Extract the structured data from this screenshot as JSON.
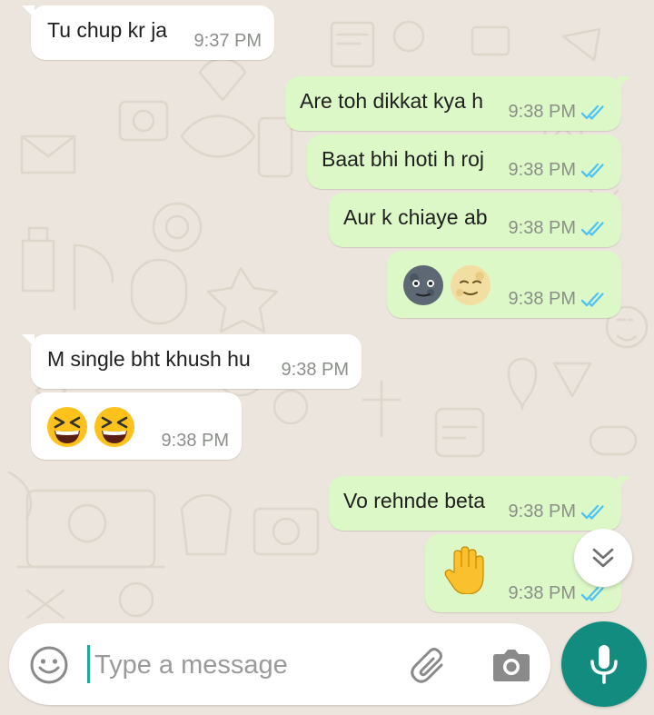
{
  "colors": {
    "incoming_bubble": "#ffffff",
    "outgoing_bubble": "#dcf8c6",
    "read_ticks": "#4fc3f7",
    "timestamp": "#8b8f8a",
    "accent": "#128c7e",
    "wallpaper": "#ece5dd"
  },
  "messages": [
    {
      "direction": "incoming",
      "text": "Tu chup kr ja",
      "time": "9:37 PM"
    },
    {
      "direction": "outgoing",
      "text": "Are toh dikkat kya h",
      "time": "9:38 PM",
      "status": "read"
    },
    {
      "direction": "outgoing",
      "text": "Baat bhi hoti h roj",
      "time": "9:38 PM",
      "status": "read"
    },
    {
      "direction": "outgoing",
      "text": "Aur k chiaye ab",
      "time": "9:38 PM",
      "status": "read"
    },
    {
      "direction": "outgoing",
      "emojis": [
        "new-moon-face-emoji",
        "full-moon-face-emoji"
      ],
      "time": "9:38 PM",
      "status": "read"
    },
    {
      "direction": "incoming",
      "text": "M single bht khush hu",
      "time": "9:38 PM"
    },
    {
      "direction": "incoming",
      "emojis": [
        "grinning-squinting-face-emoji",
        "grinning-squinting-face-emoji"
      ],
      "time": "9:38 PM"
    },
    {
      "direction": "outgoing",
      "text": "Vo rehnde beta",
      "time": "9:38 PM",
      "status": "read"
    },
    {
      "direction": "outgoing",
      "emojis": [
        "raised-hand-emoji"
      ],
      "time": "9:38 PM",
      "status": "read"
    }
  ],
  "composer": {
    "placeholder": "Type a message",
    "value": "",
    "emoji_icon": "emoji-icon",
    "attach_icon": "paperclip-icon",
    "camera_icon": "camera-icon",
    "mic_icon": "microphone-icon"
  },
  "scroll_button_icon": "double-chevron-down-icon"
}
